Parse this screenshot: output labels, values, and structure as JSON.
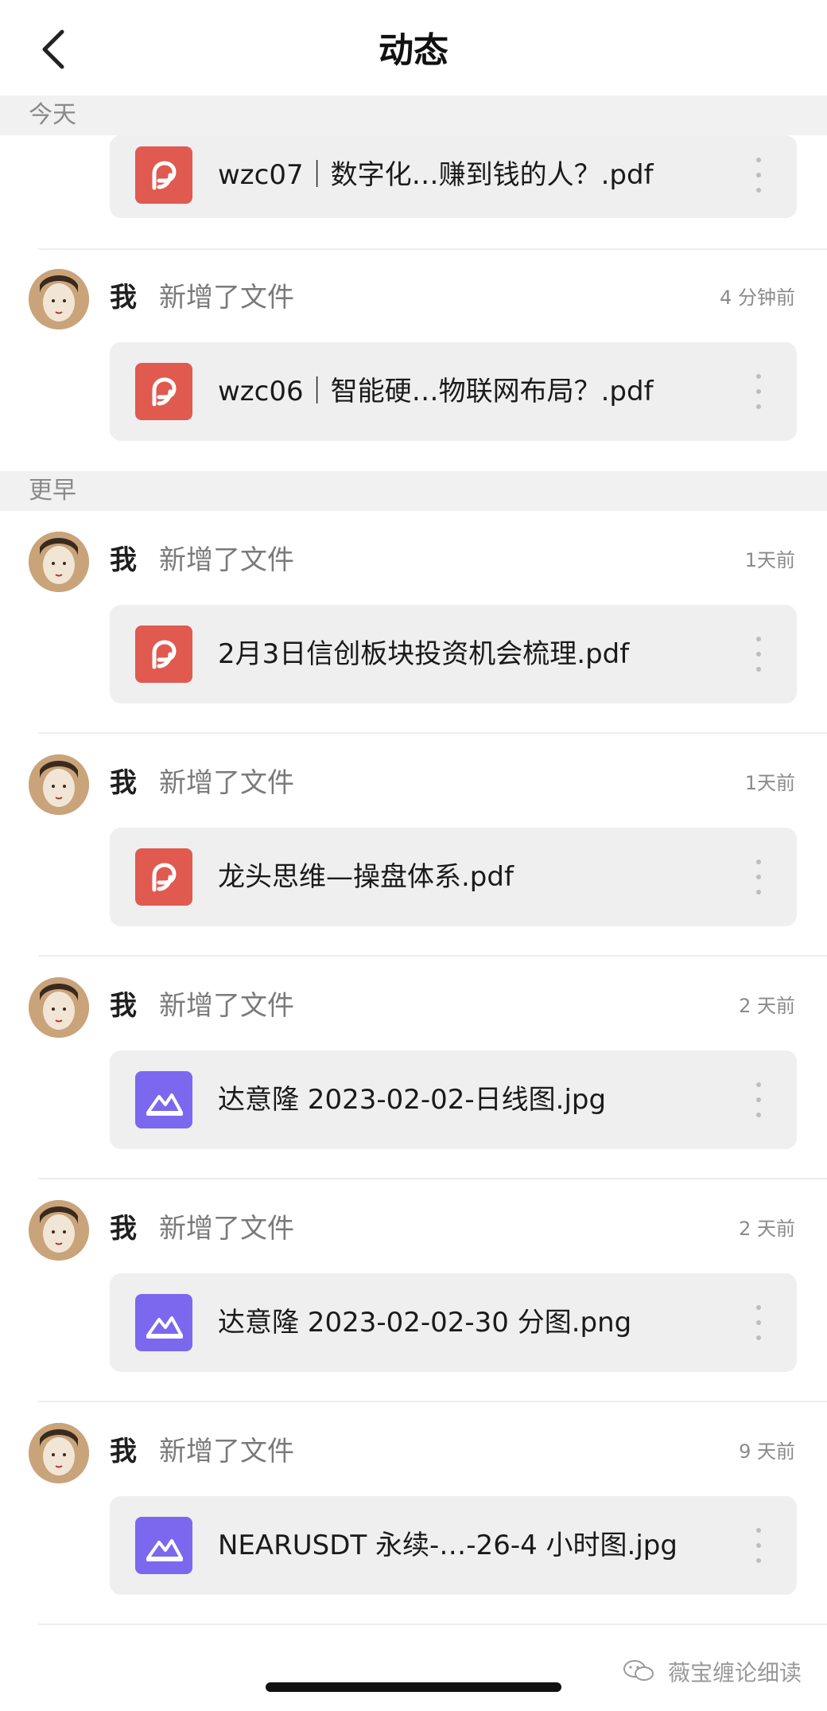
{
  "header": {
    "title": "动态"
  },
  "sections": {
    "today": "今天",
    "earlier": "更早"
  },
  "colors": {
    "pdf_icon": "#e05a4f",
    "image_icon": "#7b68ee",
    "section_bg": "#f1f1f1",
    "card_bg": "#efefef"
  },
  "items": [
    {
      "file_name": "wzc07｜数字化…赚到钱的人？.pdf",
      "file_type": "pdf-icon"
    },
    {
      "actor": "我",
      "action": "新增了文件",
      "time": "4 分钟前",
      "file_name": "wzc06｜智能硬…物联网布局？.pdf",
      "file_type": "pdf-icon"
    },
    {
      "actor": "我",
      "action": "新增了文件",
      "time": "1天前",
      "file_name": "2月3日信创板块投资机会梳理.pdf",
      "file_type": "pdf-icon"
    },
    {
      "actor": "我",
      "action": "新增了文件",
      "time": "1天前",
      "file_name": "龙头思维—操盘体系.pdf",
      "file_type": "pdf-icon"
    },
    {
      "actor": "我",
      "action": "新增了文件",
      "time": "2 天前",
      "file_name": "达意隆 2023-02-02-日线图.jpg",
      "file_type": "image-icon"
    },
    {
      "actor": "我",
      "action": "新增了文件",
      "time": "2 天前",
      "file_name": "达意隆 2023-02-02-30 分图.png",
      "file_type": "image-icon"
    },
    {
      "actor": "我",
      "action": "新增了文件",
      "time": "9 天前",
      "file_name": "NEARUSDT 永续-…-26-4 小时图.jpg",
      "file_type": "image-icon"
    }
  ],
  "watermark": "薇宝缠论细读"
}
